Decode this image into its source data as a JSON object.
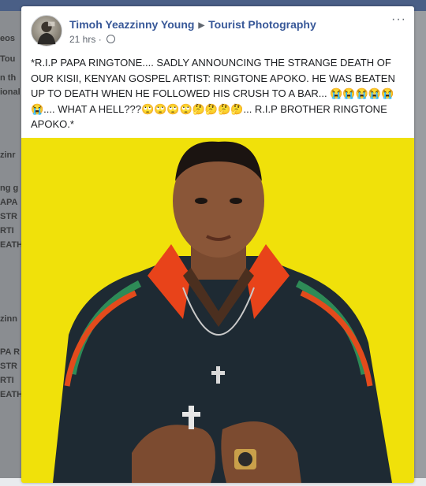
{
  "post": {
    "author": "Timoh Yeazzinny Young",
    "target_page": "Tourist Photography",
    "timestamp": "21 hrs",
    "privacy_icon": "globe-icon",
    "more_icon": "more-options-icon",
    "text": "*R.I.P PAPA RINGTONE.... SADLY ANNOUNCING THE STRANGE DEATH OF OUR KISII, KENYAN GOSPEL ARTIST: RINGTONE APOKO. HE WAS BEATEN UP TO DEATH WHEN HE FOLLOWED HIS CRUSH TO A BAR... 😭😭😭😭😭😭.... WHAT A HELL???🙄🙄🙄🙄🤔🤔🤔🤔... R.I.P BROTHER RINGTONE APOKO.*",
    "photo_background_color": "#f0e10a"
  },
  "background": {
    "left_fragments": [
      "eos",
      "Tou",
      "n th",
      "ional",
      "zinr",
      "ng g",
      "APA",
      "STR",
      "RTI",
      "EATH",
      "zinn",
      "PA R",
      "STR",
      "RTI",
      "EATH"
    ]
  },
  "colors": {
    "link": "#385898",
    "meta": "#606770",
    "text": "#1c1e21"
  }
}
